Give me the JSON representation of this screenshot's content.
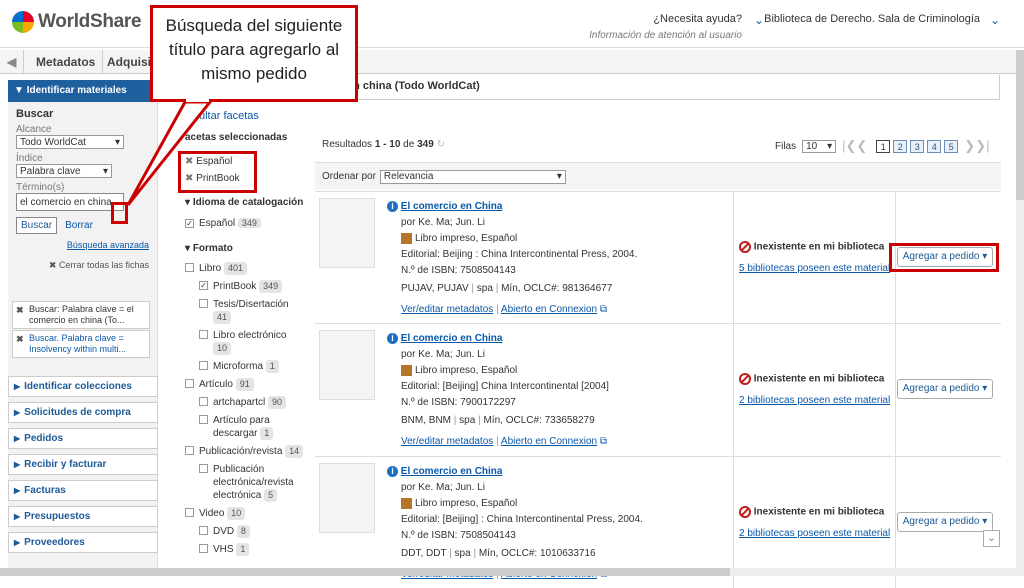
{
  "header": {
    "logo": "WorldShare",
    "help": "¿Necesita ayuda?",
    "help_sub": "Información de atención al usuario",
    "library": "Biblioteca de Derecho. Sala de Criminología"
  },
  "tabs": [
    "Metadatos",
    "Adquisi"
  ],
  "search_header": "en china (Todo WorldCat)",
  "sidebar": {
    "section": "Identificar materiales",
    "buscar": "Buscar",
    "alcance_label": "Alcance",
    "alcance": "Todo WorldCat",
    "indice_label": "Índice",
    "indice": "Palabra clave",
    "termino_label": "Término(s)",
    "termino": "el comercio en china",
    "buscar_btn": "Buscar",
    "borrar_btn": "Borrar",
    "avanzada": "Búsqueda avanzada",
    "cerrar": "Cerrar todas las fichas",
    "criteria": [
      "Buscar: Palabra clave = el comercio en china (To...",
      "Buscar. Palabra clave = Insolvency within multi..."
    ],
    "nav": [
      "Identificar colecciones",
      "Solicitudes de compra",
      "Pedidos",
      "Recibir y facturar",
      "Facturas",
      "Presupuestos",
      "Proveedores"
    ]
  },
  "facets": {
    "ocultar": "ultar facetas",
    "seleccionadas": "acetas seleccionadas",
    "selected": [
      "Español",
      "PrintBook"
    ],
    "idioma_head": "Idioma de catalogación",
    "idioma": {
      "label": "Español",
      "count": "349"
    },
    "formato_head": "Formato",
    "items": [
      {
        "label": "Libro",
        "count": "401",
        "indent": false,
        "checked": false
      },
      {
        "label": "PrintBook",
        "count": "349",
        "indent": true,
        "checked": true
      },
      {
        "label": "Tesis/Disertación",
        "count": "41",
        "indent": true,
        "checked": false
      },
      {
        "label": "Libro electrónico",
        "count": "10",
        "indent": true,
        "checked": false
      },
      {
        "label": "Microforma",
        "count": "1",
        "indent": true,
        "checked": false
      },
      {
        "label": "Artículo",
        "count": "91",
        "indent": false,
        "checked": false
      },
      {
        "label": "artchapartcl",
        "count": "90",
        "indent": true,
        "checked": false
      },
      {
        "label": "Artículo para descargar",
        "count": "1",
        "indent": true,
        "checked": false
      },
      {
        "label": "Publicación/revista",
        "count": "14",
        "indent": false,
        "checked": false
      },
      {
        "label": "Publicación electrónica/revista electrónica",
        "count": "5",
        "indent": true,
        "checked": false
      },
      {
        "label": "Video",
        "count": "10",
        "indent": false,
        "checked": false
      },
      {
        "label": "DVD",
        "count": "8",
        "indent": true,
        "checked": false
      },
      {
        "label": "VHS",
        "count": "1",
        "indent": true,
        "checked": false
      }
    ]
  },
  "results": {
    "summary_pre": "Resultados ",
    "range": "1 - 10",
    "summary_mid": " de ",
    "total": "349",
    "filas_label": "Filas",
    "filas": "10",
    "pages": [
      "1",
      "2",
      "3",
      "4",
      "5"
    ],
    "ordenar_label": "Ordenar por",
    "ordenar": "Relevancia",
    "items": [
      {
        "title": "El comercio en China",
        "author": "por Ke. Ma; Jun. Li",
        "type": "Libro impreso, Español",
        "pub": "Editorial: Beijing : China Intercontinental Press, 2004.",
        "isbn": "N.º de ISBN: 7508504143",
        "codes": "PUJAV, PUJAV",
        "lang": "spa",
        "oclc": "Mín, OCLC#: 981364677",
        "avail": "Inexistente en mi biblioteca",
        "holdings": "5 bibliotecas poseen este material"
      },
      {
        "title": "El comercio en China",
        "author": "por Ke. Ma; Jun. Li",
        "type": "Libro impreso, Español",
        "pub": "Editorial: [Beijing] China Intercontinental [2004]",
        "isbn": "N.º de ISBN: 7900172297",
        "codes": "BNM, BNM",
        "lang": "spa",
        "oclc": "Mín, OCLC#: 733658279",
        "avail": "Inexistente en mi biblioteca",
        "holdings": "2 bibliotecas poseen este material"
      },
      {
        "title": "El comercio en China",
        "author": "por Ke. Ma; Jun. Li",
        "type": "Libro impreso, Español",
        "pub": "Editorial: [Beijing] : China Intercontinental Press, 2004.",
        "isbn": "N.º de ISBN: 7508504143",
        "codes": "DDT, DDT",
        "lang": "spa",
        "oclc": "Mín, OCLC#: 1010633716",
        "avail": "Inexistente en mi biblioteca",
        "holdings": "2 bibliotecas poseen este material"
      }
    ],
    "ver": "Ver/editar metadatos",
    "abierto": "Abierto en Connexion",
    "agregar": "Agregar a pedido"
  },
  "callout": "Búsqueda del siguiente título para agregarlo al mismo pedido",
  "colors": {
    "accent": "#1e5f9e",
    "highlight": "#cc0000"
  }
}
